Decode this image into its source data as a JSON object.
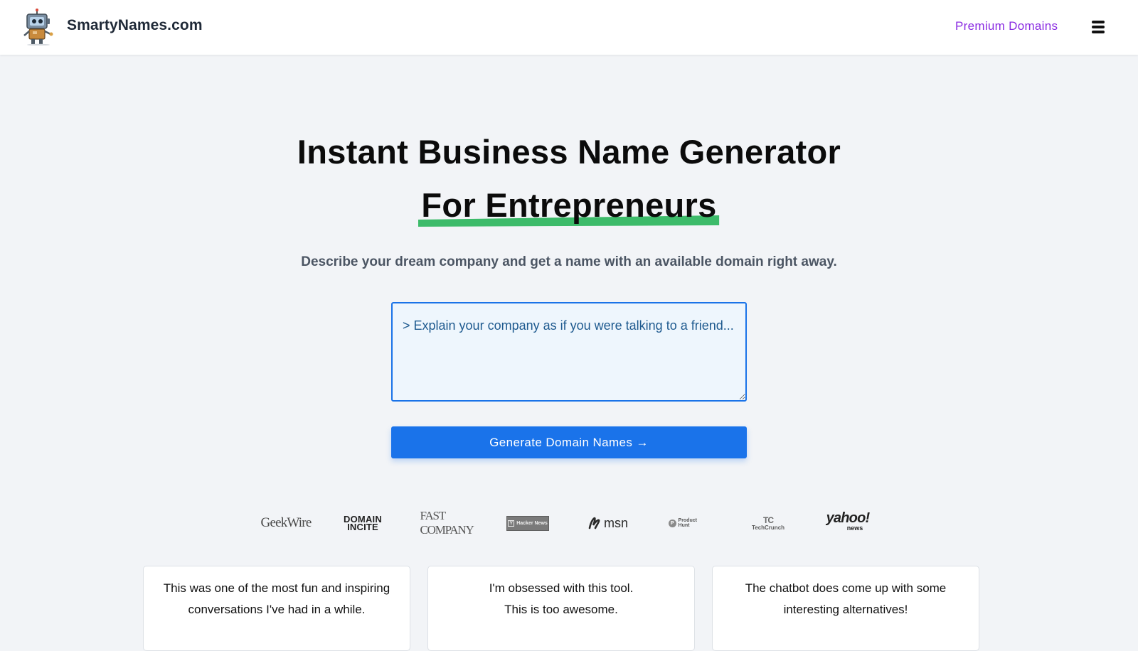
{
  "header": {
    "brand_name": "SmartyNames.com",
    "logo_icon": "robot-mascot-icon",
    "nav_link": "Premium Domains",
    "nav_link_color": "#8a2be2",
    "menu_icon": "hamburger-menu-icon"
  },
  "hero": {
    "title_line1": "Instant Business Name Generator",
    "title_line2": "For Entrepreneurs",
    "highlight_color": "#3dbb6a",
    "subtitle": "Describe your dream company and get a name with an available domain right away."
  },
  "form": {
    "description_placeholder": "> Explain your company as if you were talking to a friend...",
    "description_value": "",
    "generate_button_label": "Generate Domain Names →",
    "accent_color": "#1a73ea"
  },
  "press": {
    "logos": [
      {
        "name": "GeekWire",
        "text": "GeekWire"
      },
      {
        "name": "Domain Incite",
        "text_top": "DOMAIN",
        "text_bottom": "INCITE"
      },
      {
        "name": "Fast Company",
        "text": "FAST COMPANY"
      },
      {
        "name": "Hacker News",
        "badge": "Y",
        "text": "Hacker News"
      },
      {
        "name": "MSN",
        "text": "msn"
      },
      {
        "name": "Product Hunt",
        "badge": "P",
        "text": "Product Hunt"
      },
      {
        "name": "TechCrunch",
        "mark": "TC",
        "text": "TechCrunch"
      },
      {
        "name": "Yahoo News",
        "text": "yahoo!",
        "subtext": "news"
      }
    ]
  },
  "testimonials": [
    {
      "line1": "This was one of the most fun and inspiring",
      "line2": "conversations I've had in a while."
    },
    {
      "line1": "I'm obsessed with this tool.",
      "line2": "This is too awesome."
    },
    {
      "line1": "The chatbot does come up with some",
      "line2": "interesting alternatives!"
    }
  ]
}
